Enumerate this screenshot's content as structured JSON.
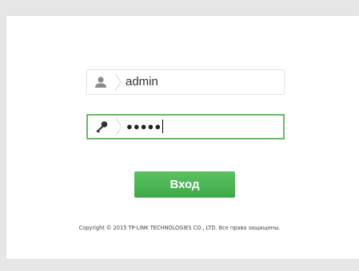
{
  "login": {
    "username_value": "admin",
    "password_masked": "●●●●●",
    "login_button_label": "Вход"
  },
  "footer": {
    "copyright": "Copyright © 2015 TP-LINK TECHNOLOGIES CO., LTD. Все права защищены."
  },
  "icons": {
    "username": "user-icon",
    "password": "key-icon"
  },
  "colors": {
    "accent_green": "#4cb454",
    "focus_border": "#6db86a",
    "background": "#e6e6e6"
  }
}
